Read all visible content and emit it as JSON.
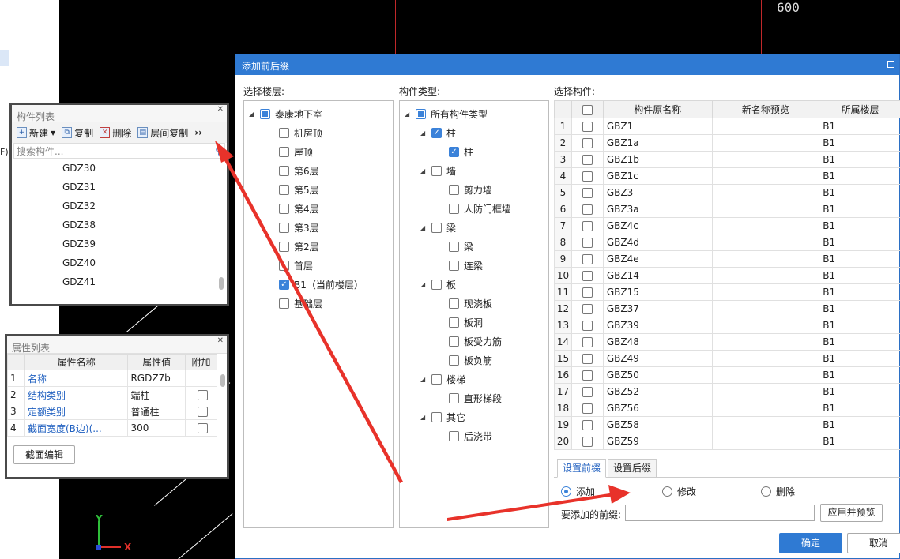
{
  "left_fragment": "F)",
  "canvas": {
    "dim_label": "600",
    "axis_x": "X",
    "axis_y": "Y"
  },
  "component_panel": {
    "title": "构件列表",
    "toolbar": {
      "new": "新建",
      "copy": "复制",
      "delete": "删除",
      "floor_copy": "层间复制",
      "more": "››"
    },
    "search_placeholder": "搜索构件...",
    "items": [
      "GDZ30",
      "GDZ31",
      "GDZ32",
      "GDZ38",
      "GDZ39",
      "GDZ40",
      "GDZ41"
    ]
  },
  "property_panel": {
    "title": "属性列表",
    "headers": [
      "属性名称",
      "属性值",
      "附加"
    ],
    "rows": [
      {
        "num": "1",
        "name": "名称",
        "value": "RGDZ7b",
        "attach": false,
        "has_cb": false
      },
      {
        "num": "2",
        "name": "结构类别",
        "value": "端柱",
        "attach": false,
        "has_cb": true
      },
      {
        "num": "3",
        "name": "定额类别",
        "value": "普通柱",
        "attach": false,
        "has_cb": true
      },
      {
        "num": "4",
        "name": "截面宽度(B边)(...",
        "value": "300",
        "attach": false,
        "has_cb": true
      }
    ],
    "edit_button": "截面编辑"
  },
  "dialog": {
    "title": "添加前后缀",
    "floor_label": "选择楼层:",
    "type_label": "构件类型:",
    "comp_label": "选择构件:",
    "floors": {
      "root": "泰康地下室",
      "items": [
        {
          "label": "机房顶",
          "checked": false
        },
        {
          "label": "屋顶",
          "checked": false
        },
        {
          "label": "第6层",
          "checked": false
        },
        {
          "label": "第5层",
          "checked": false
        },
        {
          "label": "第4层",
          "checked": false
        },
        {
          "label": "第3层",
          "checked": false
        },
        {
          "label": "第2层",
          "checked": false
        },
        {
          "label": "首层",
          "checked": false
        },
        {
          "label": "B1（当前楼层）",
          "checked": true
        },
        {
          "label": "基础层",
          "checked": false
        }
      ]
    },
    "types": {
      "root": "所有构件类型",
      "groups": [
        {
          "label": "柱",
          "checked": true,
          "children": [
            {
              "label": "柱",
              "checked": true
            }
          ]
        },
        {
          "label": "墙",
          "checked": false,
          "children": [
            {
              "label": "剪力墙",
              "checked": false
            },
            {
              "label": "人防门框墙",
              "checked": false
            }
          ]
        },
        {
          "label": "梁",
          "checked": false,
          "children": [
            {
              "label": "梁",
              "checked": false
            },
            {
              "label": "连梁",
              "checked": false
            }
          ]
        },
        {
          "label": "板",
          "checked": false,
          "children": [
            {
              "label": "现浇板",
              "checked": false
            },
            {
              "label": "板洞",
              "checked": false
            },
            {
              "label": "板受力筋",
              "checked": false
            },
            {
              "label": "板负筋",
              "checked": false
            }
          ]
        },
        {
          "label": "楼梯",
          "checked": false,
          "children": [
            {
              "label": "直形梯段",
              "checked": false
            }
          ]
        },
        {
          "label": "其它",
          "checked": false,
          "children": [
            {
              "label": "后浇带",
              "checked": false
            }
          ]
        }
      ]
    },
    "grid": {
      "headers": [
        "构件原名称",
        "新名称预览",
        "所属楼层"
      ],
      "rows": [
        {
          "n": "1",
          "name": "GBZ1",
          "floor": "B1"
        },
        {
          "n": "2",
          "name": "GBZ1a",
          "floor": "B1"
        },
        {
          "n": "3",
          "name": "GBZ1b",
          "floor": "B1"
        },
        {
          "n": "4",
          "name": "GBZ1c",
          "floor": "B1"
        },
        {
          "n": "5",
          "name": "GBZ3",
          "floor": "B1"
        },
        {
          "n": "6",
          "name": "GBZ3a",
          "floor": "B1"
        },
        {
          "n": "7",
          "name": "GBZ4c",
          "floor": "B1"
        },
        {
          "n": "8",
          "name": "GBZ4d",
          "floor": "B1"
        },
        {
          "n": "9",
          "name": "GBZ4e",
          "floor": "B1"
        },
        {
          "n": "10",
          "name": "GBZ14",
          "floor": "B1"
        },
        {
          "n": "11",
          "name": "GBZ15",
          "floor": "B1"
        },
        {
          "n": "12",
          "name": "GBZ37",
          "floor": "B1"
        },
        {
          "n": "13",
          "name": "GBZ39",
          "floor": "B1"
        },
        {
          "n": "14",
          "name": "GBZ48",
          "floor": "B1"
        },
        {
          "n": "15",
          "name": "GBZ49",
          "floor": "B1"
        },
        {
          "n": "16",
          "name": "GBZ50",
          "floor": "B1"
        },
        {
          "n": "17",
          "name": "GBZ52",
          "floor": "B1"
        },
        {
          "n": "18",
          "name": "GBZ56",
          "floor": "B1"
        },
        {
          "n": "19",
          "name": "GBZ58",
          "floor": "B1"
        },
        {
          "n": "20",
          "name": "GBZ59",
          "floor": "B1"
        }
      ]
    },
    "tabs": [
      "设置前缀",
      "设置后缀"
    ],
    "radios": [
      "添加",
      "修改",
      "删除"
    ],
    "prefix_label": "要添加的前缀:",
    "prefix_value": "",
    "apply_button": "应用并预览",
    "ok_button": "确定",
    "cancel_button": "取消"
  },
  "colors": {
    "accent": "#2f7ad3",
    "annotation_arrow": "#e8322a",
    "checkbox": "#3b82d9"
  }
}
